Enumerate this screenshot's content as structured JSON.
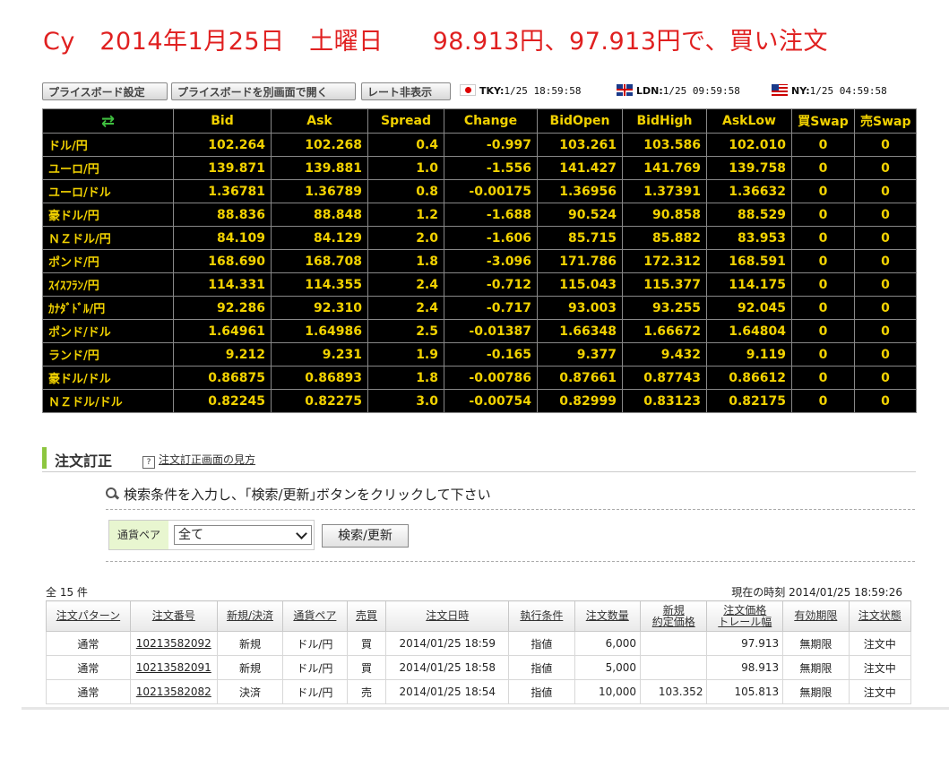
{
  "title": "Cy　2014年1月25日　土曜日　　98.913円、97.913円で、買い注文",
  "toolbar": {
    "buttons": [
      "プライスボード設定",
      "プライスボードを別画面で開く",
      "レート非表示"
    ],
    "clocks": [
      {
        "flag": "japan-flag-icon",
        "label": "TKY:",
        "time": "1/25 18:59:58"
      },
      {
        "flag": "uk-flag-icon",
        "label": "LDN:",
        "time": "1/25 09:59:58"
      },
      {
        "flag": "us-flag-icon",
        "label": "NY:",
        "time": "1/25 04:59:58"
      }
    ]
  },
  "rates": {
    "refresh_icon": "⇄",
    "headers": [
      "Bid",
      "Ask",
      "Spread",
      "Change",
      "BidOpen",
      "BidHigh",
      "AskLow",
      "買Swap",
      "売Swap"
    ],
    "rows": [
      {
        "pair": "ドル/円",
        "bid": "102.264",
        "ask": "102.268",
        "spread": "0.4",
        "change": "-0.997",
        "open": "103.261",
        "high": "103.586",
        "low": "102.010",
        "buy_swap": "0",
        "sell_swap": "0"
      },
      {
        "pair": "ユーロ/円",
        "bid": "139.871",
        "ask": "139.881",
        "spread": "1.0",
        "change": "-1.556",
        "open": "141.427",
        "high": "141.769",
        "low": "139.758",
        "buy_swap": "0",
        "sell_swap": "0"
      },
      {
        "pair": "ユーロ/ドル",
        "bid": "1.36781",
        "ask": "1.36789",
        "spread": "0.8",
        "change": "-0.00175",
        "open": "1.36956",
        "high": "1.37391",
        "low": "1.36632",
        "buy_swap": "0",
        "sell_swap": "0"
      },
      {
        "pair": "豪ドル/円",
        "bid": "88.836",
        "ask": "88.848",
        "spread": "1.2",
        "change": "-1.688",
        "open": "90.524",
        "high": "90.858",
        "low": "88.529",
        "buy_swap": "0",
        "sell_swap": "0"
      },
      {
        "pair": "ＮＺドル/円",
        "bid": "84.109",
        "ask": "84.129",
        "spread": "2.0",
        "change": "-1.606",
        "open": "85.715",
        "high": "85.882",
        "low": "83.953",
        "buy_swap": "0",
        "sell_swap": "0"
      },
      {
        "pair": "ポンド/円",
        "bid": "168.690",
        "ask": "168.708",
        "spread": "1.8",
        "change": "-3.096",
        "open": "171.786",
        "high": "172.312",
        "low": "168.591",
        "buy_swap": "0",
        "sell_swap": "0"
      },
      {
        "pair": "ｽｲｽﾌﾗﾝ/円",
        "bid": "114.331",
        "ask": "114.355",
        "spread": "2.4",
        "change": "-0.712",
        "open": "115.043",
        "high": "115.377",
        "low": "114.175",
        "buy_swap": "0",
        "sell_swap": "0"
      },
      {
        "pair": "ｶﾅﾀﾞﾄﾞﾙ/円",
        "bid": "92.286",
        "ask": "92.310",
        "spread": "2.4",
        "change": "-0.717",
        "open": "93.003",
        "high": "93.255",
        "low": "92.045",
        "buy_swap": "0",
        "sell_swap": "0"
      },
      {
        "pair": "ポンド/ドル",
        "bid": "1.64961",
        "ask": "1.64986",
        "spread": "2.5",
        "change": "-0.01387",
        "open": "1.66348",
        "high": "1.66672",
        "low": "1.64804",
        "buy_swap": "0",
        "sell_swap": "0"
      },
      {
        "pair": "ランド/円",
        "bid": "9.212",
        "ask": "9.231",
        "spread": "1.9",
        "change": "-0.165",
        "open": "9.377",
        "high": "9.432",
        "low": "9.119",
        "buy_swap": "0",
        "sell_swap": "0"
      },
      {
        "pair": "豪ドル/ドル",
        "bid": "0.86875",
        "ask": "0.86893",
        "spread": "1.8",
        "change": "-0.00786",
        "open": "0.87661",
        "high": "0.87743",
        "low": "0.86612",
        "buy_swap": "0",
        "sell_swap": "0"
      },
      {
        "pair": "ＮＺドル/ドル",
        "bid": "0.82245",
        "ask": "0.82275",
        "spread": "3.0",
        "change": "-0.00754",
        "open": "0.82999",
        "high": "0.83123",
        "low": "0.82175",
        "buy_swap": "0",
        "sell_swap": "0"
      }
    ]
  },
  "section": {
    "title": "注文訂正",
    "help_link": "注文訂正画面の見方"
  },
  "search": {
    "instruction": "検索条件を入力し、｢検索/更新｣ボタンをクリックして下さい",
    "filter_label": "通貨ペア",
    "filter_value": "全て",
    "button": "検索/更新"
  },
  "orders": {
    "count": "全 15 件",
    "now_label": "現在の時刻 2014/01/25 18:59:26",
    "headers": [
      "注文パターン",
      "注文番号",
      "新規/決済",
      "通貨ペア",
      "売買",
      "注文日時",
      "執行条件",
      "注文数量",
      "新規\n約定価格",
      "注文価格\nトレール幅",
      "有効期限",
      "注文状態"
    ],
    "rows": [
      {
        "pattern": "通常",
        "number": "10213582092",
        "type": "新規",
        "pair": "ドル/円",
        "side": "買",
        "datetime": "2014/01/25 18:59",
        "condition": "指値",
        "qty": "6,000",
        "fill_price": "",
        "order_price": "97.913",
        "expiry": "無期限",
        "status": "注文中"
      },
      {
        "pattern": "通常",
        "number": "10213582091",
        "type": "新規",
        "pair": "ドル/円",
        "side": "買",
        "datetime": "2014/01/25 18:58",
        "condition": "指値",
        "qty": "5,000",
        "fill_price": "",
        "order_price": "98.913",
        "expiry": "無期限",
        "status": "注文中"
      },
      {
        "pattern": "通常",
        "number": "10213582082",
        "type": "決済",
        "pair": "ドル/円",
        "side": "売",
        "datetime": "2014/01/25 18:54",
        "condition": "指値",
        "qty": "10,000",
        "fill_price": "103.352",
        "order_price": "105.813",
        "expiry": "無期限",
        "status": "注文中"
      }
    ]
  },
  "colors": {
    "title": "#e02020",
    "rate_text": "#f2d200",
    "accent": "#8dc63f",
    "buy": "#c00000",
    "sell": "#0040c0"
  }
}
